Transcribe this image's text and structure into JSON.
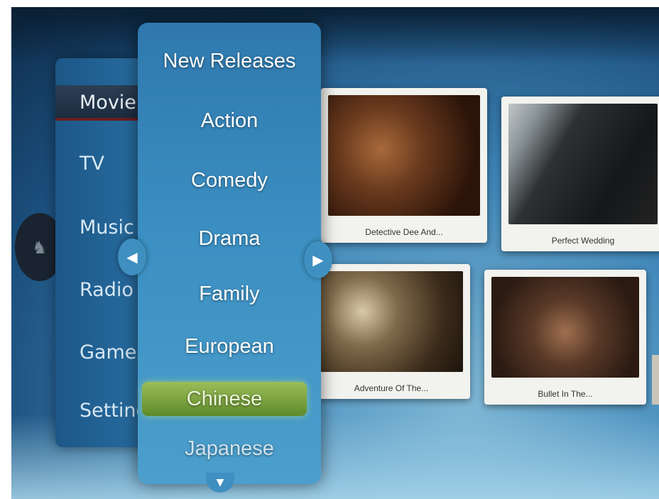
{
  "main_menu": {
    "items": [
      {
        "label": "Movie",
        "active": true
      },
      {
        "label": "TV"
      },
      {
        "label": "Music"
      },
      {
        "label": "Radio"
      },
      {
        "label": "Games"
      },
      {
        "label": "Settings"
      }
    ]
  },
  "genre_menu": {
    "items": [
      {
        "label": "New Releases"
      },
      {
        "label": "Action"
      },
      {
        "label": "Comedy"
      },
      {
        "label": "Drama"
      },
      {
        "label": "Family"
      },
      {
        "label": "European"
      },
      {
        "label": "Chinese",
        "selected": true
      },
      {
        "label": "Japanese"
      }
    ],
    "prev_icon": "chevron-left-icon",
    "next_icon": "chevron-right-icon",
    "more_icon": "chevron-down-icon"
  },
  "titles": [
    {
      "caption": "Detective Dee And..."
    },
    {
      "caption": "Perfect Wedding"
    },
    {
      "caption": "Adventure Of The..."
    },
    {
      "caption": "Bullet In The..."
    }
  ],
  "colors": {
    "selected_highlight": "#7fa642",
    "menu_blue": "#3b8fc2"
  }
}
